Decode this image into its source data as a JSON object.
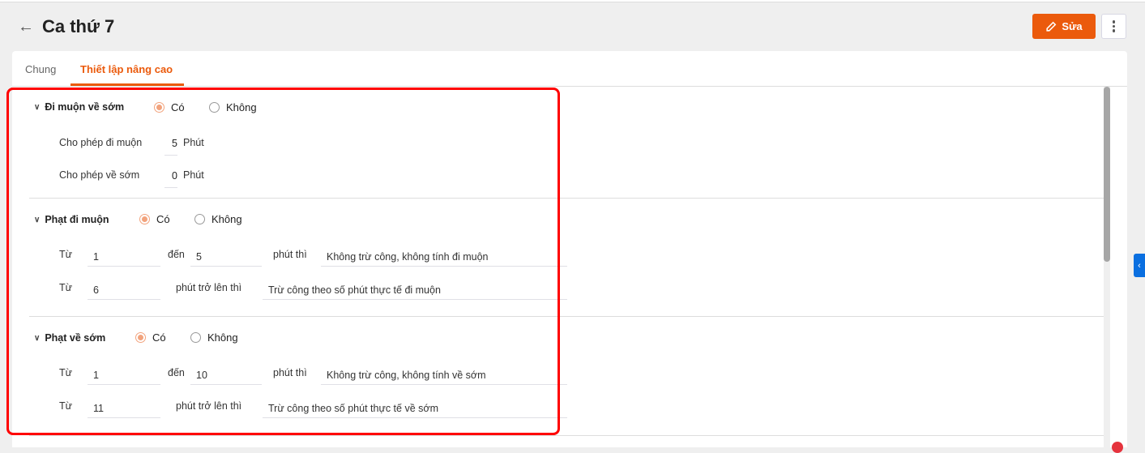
{
  "header": {
    "title": "Ca thứ 7",
    "edit_label": "Sửa"
  },
  "tabs": [
    {
      "label": "Chung"
    },
    {
      "label": "Thiết lập nâng cao"
    }
  ],
  "sections": [
    {
      "title": "Đi muộn về sớm",
      "yes": "Có",
      "no": "Không",
      "selected": "Có",
      "rows": [
        {
          "label": "Cho phép đi muộn",
          "value": "5",
          "unit": "Phút"
        },
        {
          "label": "Cho phép về sớm",
          "value": "0",
          "unit": "Phút"
        }
      ]
    },
    {
      "title": "Phạt đi muộn",
      "yes": "Có",
      "no": "Không",
      "selected": "Có",
      "range": {
        "from": "Từ",
        "from_value": "1",
        "to": "đến",
        "to_value": "5",
        "then": "phút thì",
        "result": "Không trừ công, không tính đi muộn"
      },
      "above": {
        "from": "Từ",
        "value": "6",
        "then": "phút trở lên thì",
        "result": "Trừ công theo số phút thực tế đi muộn"
      }
    },
    {
      "title": "Phạt về sớm",
      "yes": "Có",
      "no": "Không",
      "selected": "Có",
      "range": {
        "from": "Từ",
        "from_value": "1",
        "to": "đến",
        "to_value": "10",
        "then": "phút thì",
        "result": "Không trừ công, không tính về sớm"
      },
      "above": {
        "from": "Từ",
        "value": "11",
        "then": "phút trở lên thì",
        "result": "Trừ công theo số phút thực tế về sớm"
      }
    }
  ],
  "colors": {
    "accent": "#eb5a0c",
    "highlight": "#ff0000"
  }
}
